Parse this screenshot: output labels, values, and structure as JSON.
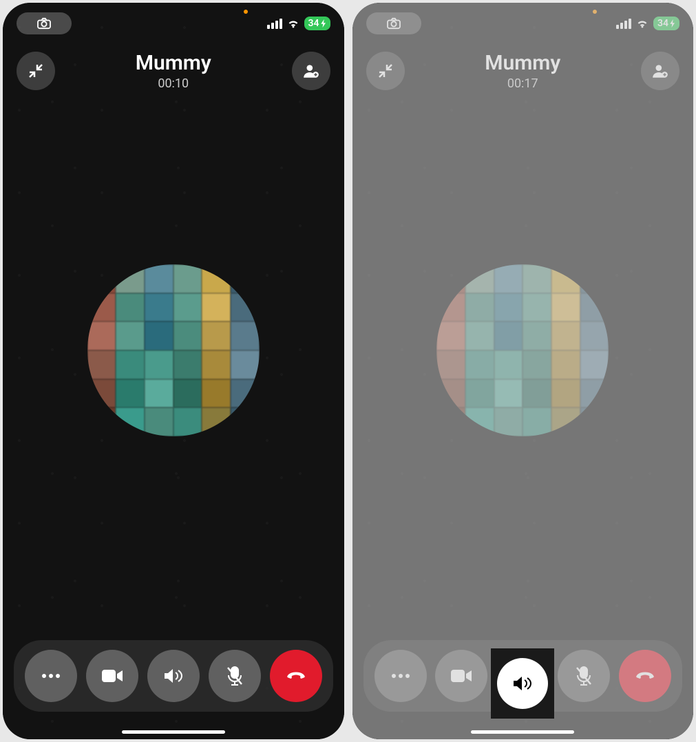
{
  "screens": [
    {
      "status_bar": {
        "battery_text": "34",
        "orange_dot": true
      },
      "header": {
        "contact_name": "Mummy",
        "call_timer": "00:10"
      },
      "controls": {
        "more_label": "more-options",
        "video_label": "video-toggle",
        "speaker_label": "speaker-toggle",
        "mute_label": "mute-toggle",
        "end_label": "end-call"
      },
      "speaker_active": false,
      "dimmed": false
    },
    {
      "status_bar": {
        "battery_text": "34",
        "orange_dot": true
      },
      "header": {
        "contact_name": "Mummy",
        "call_timer": "00:17"
      },
      "controls": {
        "more_label": "more-options",
        "video_label": "video-toggle",
        "speaker_label": "speaker-toggle",
        "mute_label": "mute-toggle",
        "end_label": "end-call"
      },
      "speaker_active": true,
      "dimmed": true
    }
  ],
  "avatar_colors": [
    "#8b4a3a",
    "#7a9b8c",
    "#5a8b9c",
    "#6b9c8d",
    "#c9a84b",
    "#3a5b6c",
    "#9b5a4a",
    "#4a8b7c",
    "#3a7b8c",
    "#5b9c8d",
    "#d4b25b",
    "#4a6b7c",
    "#ab6a5a",
    "#5a9b8c",
    "#2a6b7c",
    "#4b8c7d",
    "#b89a4b",
    "#5a7b8c",
    "#8b5a4a",
    "#3a8b7c",
    "#4a9b8c",
    "#3b7c6d",
    "#a88a3b",
    "#6a8b9c",
    "#7b4a3a",
    "#2a7b6c",
    "#5aab9c",
    "#2b6c5d",
    "#987a2b",
    "#4a6b7c",
    "#6b3a2a",
    "#3a9b8c",
    "#4a8b7c",
    "#3b8c7d",
    "#887a3b",
    "#3a5b6c"
  ]
}
